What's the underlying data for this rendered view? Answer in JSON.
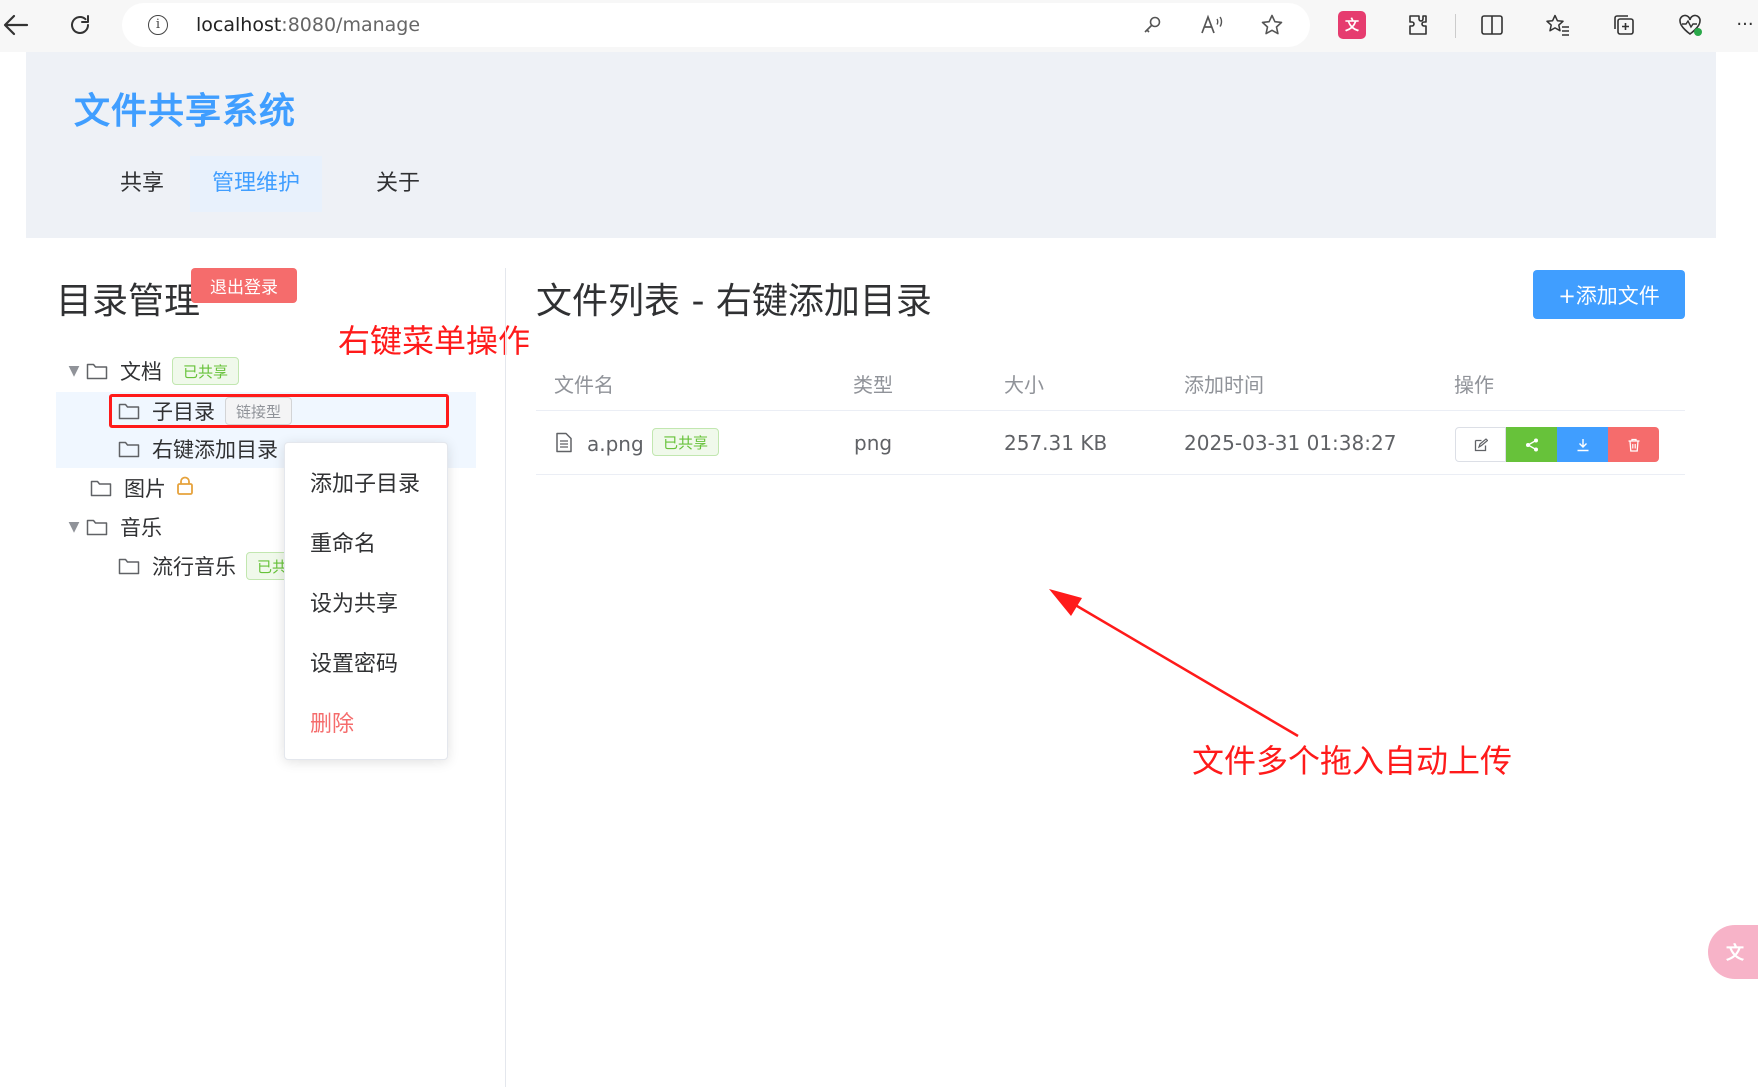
{
  "browser": {
    "url_host": "localhost",
    "url_rest": ":8080/manage",
    "icons": [
      "back-icon",
      "refresh-icon",
      "info-icon",
      "key-icon",
      "read-aloud-icon",
      "favorite-star-icon",
      "translate-ext-icon",
      "extensions-icon",
      "split-screen-icon",
      "favorites-icon",
      "collections-icon",
      "health-icon",
      "more-icon"
    ],
    "more": "···"
  },
  "app": {
    "title": "文件共享系统",
    "nav": [
      "共享",
      "管理维护",
      "关于"
    ],
    "active_nav": "管理维护"
  },
  "directory": {
    "heading": "目录管理",
    "logout_label": "退出登录",
    "tree": [
      {
        "label": "文档",
        "tag": "已共享",
        "tag_type": "green",
        "expanded": true
      },
      {
        "label": "子目录",
        "tag": "链接型",
        "tag_type": "gray",
        "level": 2
      },
      {
        "label": "右键添加目录",
        "level": 2
      },
      {
        "label": "图片",
        "locked": true
      },
      {
        "label": "音乐",
        "expanded": true
      },
      {
        "label": "流行音乐",
        "tag": "已共",
        "tag_type": "green",
        "level": 2
      }
    ]
  },
  "context_menu": {
    "items": [
      "添加子目录",
      "重命名",
      "设为共享",
      "设置密码",
      "删除"
    ]
  },
  "file_list": {
    "heading": "文件列表 - 右键添加目录",
    "add_button": "+添加文件",
    "columns": [
      "文件名",
      "类型",
      "大小",
      "添加时间",
      "操作"
    ],
    "rows": [
      {
        "name": "a.png",
        "tag": "已共享",
        "type": "png",
        "size": "257.31 KB",
        "time": "2025-03-31 01:38:27"
      }
    ]
  },
  "annotations": {
    "right_click": "右键菜单操作",
    "upload": "文件多个拖入自动上传",
    "color": "#ff1a1a"
  },
  "colors": {
    "primary": "#409eff",
    "success": "#67c23a",
    "danger": "#f56c6c",
    "header_bg": "#eef1f6"
  }
}
